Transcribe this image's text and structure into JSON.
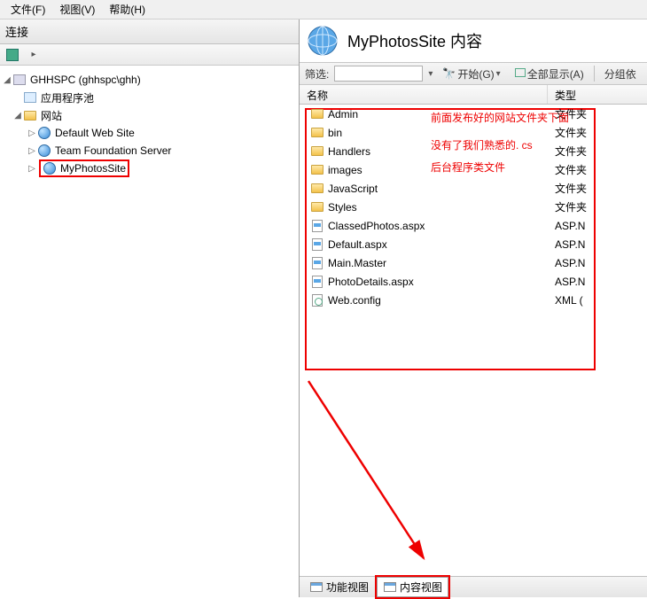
{
  "menu": {
    "file": "文件(F)",
    "view": "视图(V)",
    "help": "帮助(H)"
  },
  "left": {
    "title": "连接",
    "root": "GHHSPC (ghhspc\\ghh)",
    "apppool": "应用程序池",
    "sites": "网站",
    "site1": "Default Web Site",
    "site2": "Team Foundation Server",
    "site3": "MyPhotosSite"
  },
  "header": {
    "title": "MyPhotosSite 内容"
  },
  "filter": {
    "label": "筛选:",
    "go": "开始(G)",
    "showall": "全部显示(A)",
    "groupby": "分组依"
  },
  "columns": {
    "name": "名称",
    "type": "类型"
  },
  "rows": [
    {
      "name": "Admin",
      "type": "文件夹",
      "icon": "folder"
    },
    {
      "name": "bin",
      "type": "文件夹",
      "icon": "folder"
    },
    {
      "name": "Handlers",
      "type": "文件夹",
      "icon": "folder"
    },
    {
      "name": "images",
      "type": "文件夹",
      "icon": "folder"
    },
    {
      "name": "JavaScript",
      "type": "文件夹",
      "icon": "folder"
    },
    {
      "name": "Styles",
      "type": "文件夹",
      "icon": "folder"
    },
    {
      "name": "ClassedPhotos.aspx",
      "type": "ASP.N",
      "icon": "aspx"
    },
    {
      "name": "Default.aspx",
      "type": "ASP.N",
      "icon": "aspx"
    },
    {
      "name": "Main.Master",
      "type": "ASP.N",
      "icon": "aspx"
    },
    {
      "name": "PhotoDetails.aspx",
      "type": "ASP.N",
      "icon": "aspx"
    },
    {
      "name": "Web.config",
      "type": "XML (",
      "icon": "conf"
    }
  ],
  "annotation": {
    "line1": "前面发布好的网站文件夹下面",
    "line2": "没有了我们熟悉的. cs",
    "line3": "后台程序类文件"
  },
  "tabs": {
    "features": "功能视图",
    "content": "内容视图"
  }
}
